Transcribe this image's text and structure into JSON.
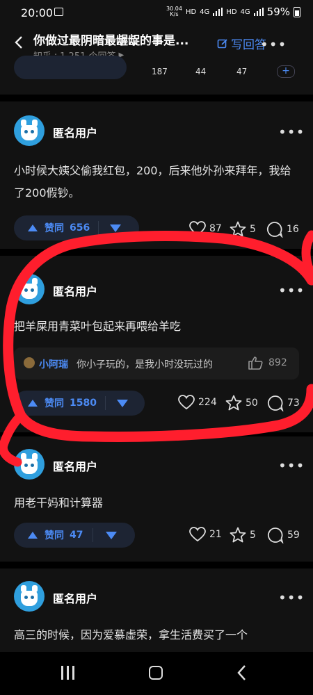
{
  "status": {
    "time": "20:00",
    "speed_top": "30.04",
    "speed_bottom": "K/s",
    "hd1": "HD",
    "net1": "4G",
    "hd2": "HD",
    "net2": "4G",
    "battery": "59%"
  },
  "header": {
    "title": "你做过最阴暗最龌龊的事是...",
    "source": "知乎",
    "dot": "·",
    "answer_count": "1,251 个回答",
    "play_glyph": "▶",
    "write_label": "写回答",
    "more": "•••"
  },
  "prev": {
    "n1": "187",
    "n2": "44",
    "n3": "47",
    "plus": "+"
  },
  "answers": [
    {
      "user": "匿名用户",
      "more": "•••",
      "text": "小时候大姨父偷我红包，200，后来他外孙来拜年，我给了200假钞。",
      "vote_label": "赞同",
      "votes": "656",
      "likes": "87",
      "stars": "5",
      "comments": "16"
    },
    {
      "user": "匿名用户",
      "more": "•••",
      "text": "把羊屎用青菜叶包起来再喂给羊吃",
      "comment": {
        "name": "小阿瑞",
        "text": "你小子玩的，是我小时没玩过的",
        "likes": "892"
      },
      "vote_label": "赞同",
      "votes": "1580",
      "likes": "224",
      "stars": "50",
      "comments": "73"
    },
    {
      "user": "匿名用户",
      "more": "•••",
      "text": "用老干妈和计算器",
      "vote_label": "赞同",
      "votes": "47",
      "likes": "21",
      "stars": "5",
      "comments": "59"
    },
    {
      "user": "匿名用户",
      "more": "•••",
      "text": "高三的时候，因为爱慕虚荣，拿生活费买了一个"
    }
  ],
  "colors": {
    "accent": "#4c8bf5",
    "annotation_red": "#ff1e2d",
    "background": "#121212"
  },
  "icons": {
    "back": "chevron-left-icon",
    "write": "edit-icon",
    "heart": "heart-icon",
    "star": "star-icon",
    "comment": "comment-icon",
    "like": "thumb-up-icon"
  }
}
